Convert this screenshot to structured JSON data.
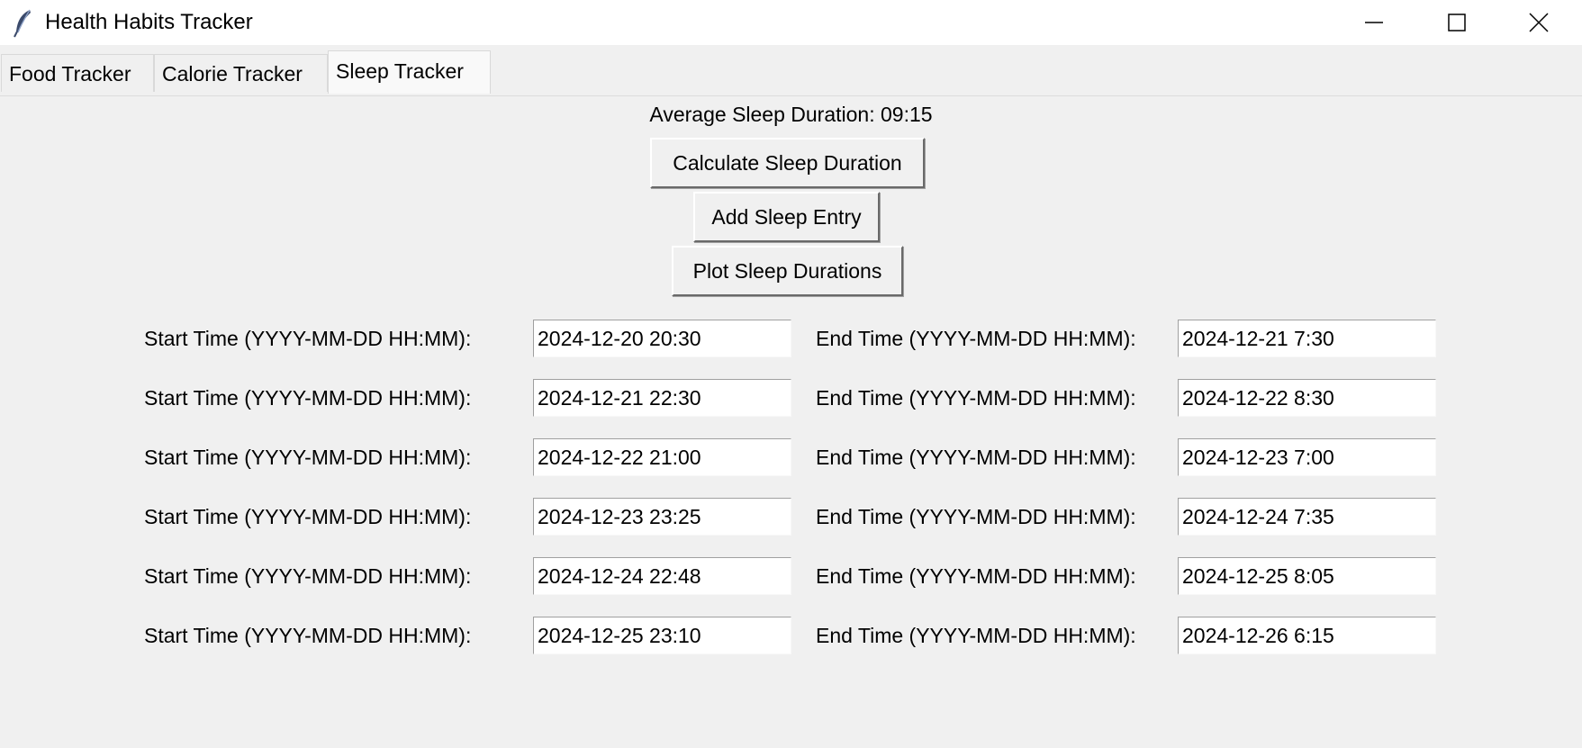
{
  "window": {
    "title": "Health Habits Tracker",
    "icon": "feather-icon",
    "controls": [
      "minimize-icon",
      "maximize-icon",
      "close-icon"
    ]
  },
  "tabs": [
    {
      "label": "Food Tracker",
      "active": false
    },
    {
      "label": "Calorie Tracker",
      "active": false
    },
    {
      "label": "Sleep Tracker",
      "active": true
    }
  ],
  "sleep": {
    "average_label": "Average Sleep Duration: 09:15",
    "buttons": {
      "calculate": "Calculate Sleep Duration",
      "add": "Add Sleep Entry",
      "plot": "Plot Sleep Durations"
    },
    "start_label": "Start Time (YYYY-MM-DD HH:MM):",
    "end_label": "End Time (YYYY-MM-DD HH:MM):",
    "entries": [
      {
        "start": "2024-12-20 20:30",
        "end": "2024-12-21 7:30"
      },
      {
        "start": "2024-12-21 22:30",
        "end": "2024-12-22 8:30"
      },
      {
        "start": "2024-12-22 21:00",
        "end": "2024-12-23 7:00"
      },
      {
        "start": "2024-12-23 23:25",
        "end": "2024-12-24 7:35"
      },
      {
        "start": "2024-12-24 22:48",
        "end": "2024-12-25 8:05"
      },
      {
        "start": "2024-12-25 23:10",
        "end": "2024-12-26 6:15"
      }
    ]
  }
}
